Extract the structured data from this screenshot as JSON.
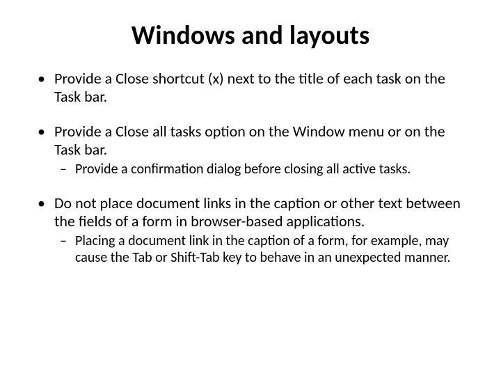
{
  "title": "Windows and layouts",
  "bullets": [
    {
      "text": "Provide a Close shortcut (x) next to the title of each task on the Task bar.",
      "sub": []
    },
    {
      "text": "Provide a Close all tasks option on the Window menu or on the Task bar.",
      "sub": [
        "Provide a confirmation dialog before closing all active tasks."
      ]
    },
    {
      "text": "Do not place document links in the caption or other text between the fields of a form in browser-based applications.",
      "sub": [
        "Placing a document link in the caption of a form, for example, may cause the Tab or Shift-Tab key to behave in an unexpected manner."
      ]
    }
  ]
}
